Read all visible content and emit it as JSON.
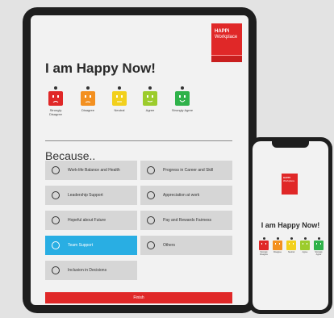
{
  "tablet": {
    "logo": {
      "brand": "HAPPi",
      "sub": "Workplace"
    },
    "title": "I am Happy Now!",
    "faces": [
      {
        "label": "Strongly Disagree",
        "color": "#e02828",
        "mood": "very-sad"
      },
      {
        "label": "Disagree",
        "color": "#f39020",
        "mood": "sad"
      },
      {
        "label": "Neutral",
        "color": "#f2d01c",
        "mood": "neutral"
      },
      {
        "label": "Agree",
        "color": "#9ccc2c",
        "mood": "happy"
      },
      {
        "label": "Strongly Agree",
        "color": "#2fb24a",
        "mood": "very-happy"
      }
    ],
    "because_label": "Because..",
    "options": [
      {
        "label": "Work-life Balance and Health",
        "selected": false
      },
      {
        "label": "Progress in Career and Skill",
        "selected": false
      },
      {
        "label": "Leadership Support",
        "selected": false
      },
      {
        "label": "Appreciation at work",
        "selected": false
      },
      {
        "label": "Hopeful about Future",
        "selected": false
      },
      {
        "label": "Pay and Rewards Fairness",
        "selected": false
      },
      {
        "label": "Team Support",
        "selected": true
      },
      {
        "label": "Others",
        "selected": false
      },
      {
        "label": "Inclusion in Decisions",
        "selected": false
      }
    ],
    "finish_label": "Finish"
  },
  "phone": {
    "logo": {
      "brand": "HAPPi",
      "sub": "Workplace"
    },
    "title": "I am Happy Now!",
    "faces": [
      {
        "label": "Strongly Disagree",
        "color": "#e02828"
      },
      {
        "label": "Disagree",
        "color": "#f39020"
      },
      {
        "label": "Neutral",
        "color": "#f2d01c"
      },
      {
        "label": "Agree",
        "color": "#9ccc2c"
      },
      {
        "label": "Strongly Agree",
        "color": "#2fb24a"
      }
    ]
  },
  "colors": {
    "accent": "#e02828",
    "selected": "#29aee3",
    "option_bg": "#d6d6d6"
  }
}
